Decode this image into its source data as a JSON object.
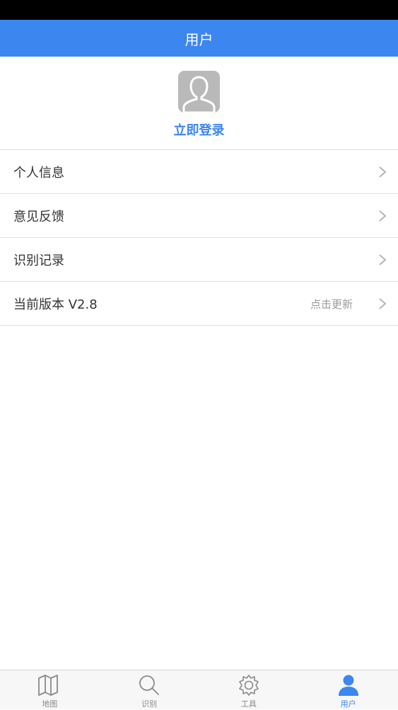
{
  "header": {
    "title": "用户"
  },
  "profile": {
    "avatar_icon": "default-avatar-icon",
    "login_label": "立即登录"
  },
  "menu": {
    "items": [
      {
        "label": "个人信息",
        "icon": "chevron-right-icon"
      },
      {
        "label": "意见反馈",
        "icon": "chevron-right-icon"
      },
      {
        "label": "识别记录",
        "icon": "chevron-right-icon"
      },
      {
        "label": "当前版本 V2.8",
        "extra": "点击更新",
        "icon": "chevron-right-icon"
      }
    ]
  },
  "tabbar": {
    "items": [
      {
        "label": "地图",
        "icon": "map-icon",
        "active": false
      },
      {
        "label": "识别",
        "icon": "search-icon",
        "active": false
      },
      {
        "label": "工具",
        "icon": "gear-icon",
        "active": false
      },
      {
        "label": "用户",
        "icon": "user-icon",
        "active": true
      }
    ]
  },
  "colors": {
    "accent": "#3c86f0",
    "status_bar": "#000000",
    "divider": "#e0e0e0"
  }
}
